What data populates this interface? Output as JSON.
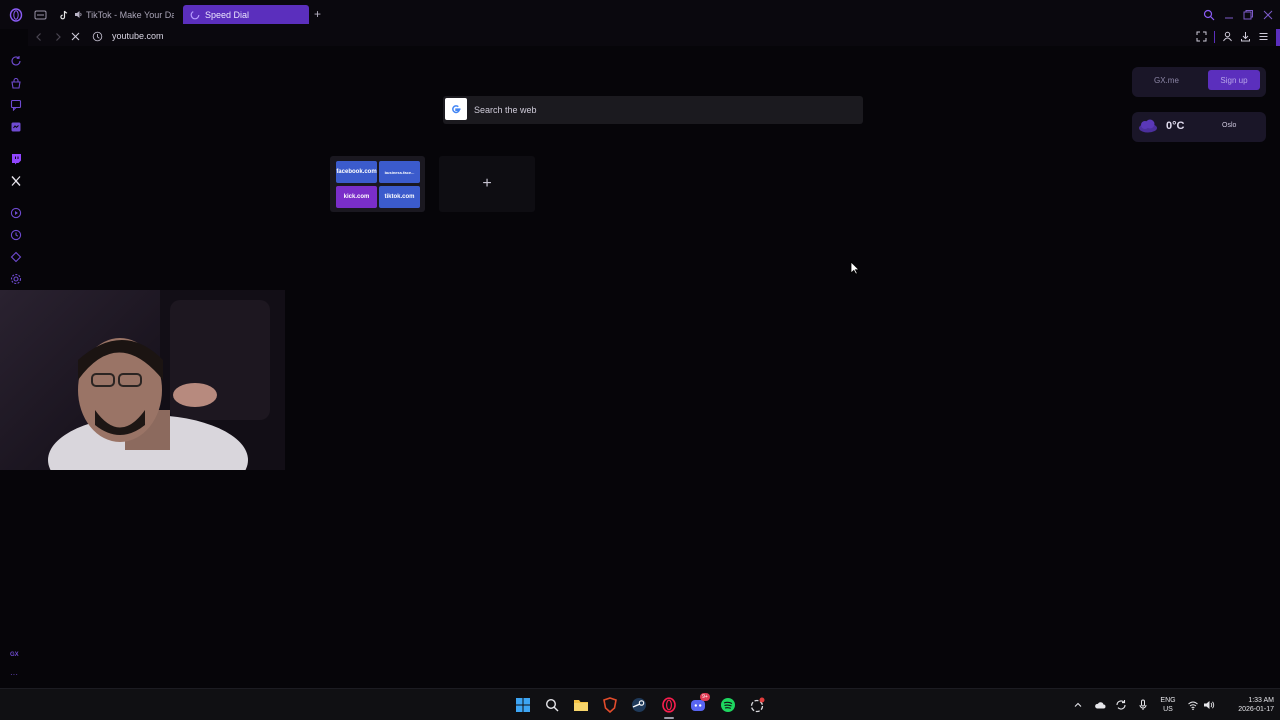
{
  "tabs": [
    {
      "label": "TikTok - Make Your Da",
      "active": false
    },
    {
      "label": "Speed Dial",
      "active": true
    }
  ],
  "address": {
    "url": "youtube.com"
  },
  "search": {
    "engine_icon": "google-icon",
    "placeholder": "Search the web"
  },
  "speed_dial": {
    "folder_tiles": [
      {
        "label": "facebook.com",
        "color": "#3b5bcc"
      },
      {
        "label": "business.face...",
        "color": "#3b5bcc"
      },
      {
        "label": "kick.com",
        "color": "#7a2ec9"
      },
      {
        "label": "tiktok.com",
        "color": "#3b5bcc"
      }
    ],
    "add_label": "+"
  },
  "widgets": {
    "gx": {
      "link_label": "GX.me",
      "signup_label": "Sign up"
    },
    "weather": {
      "temperature": "0°C",
      "city": "Oslo"
    }
  },
  "sidebar": {
    "bottom_label": "GX",
    "more_label": "···"
  },
  "taskbar": {
    "language": "ENG",
    "region": "US",
    "time": "1:33 AM",
    "date": "2026-01-17",
    "discord_badge": "9+"
  },
  "colors": {
    "accent": "#5b2fbd",
    "background": "#060509"
  }
}
